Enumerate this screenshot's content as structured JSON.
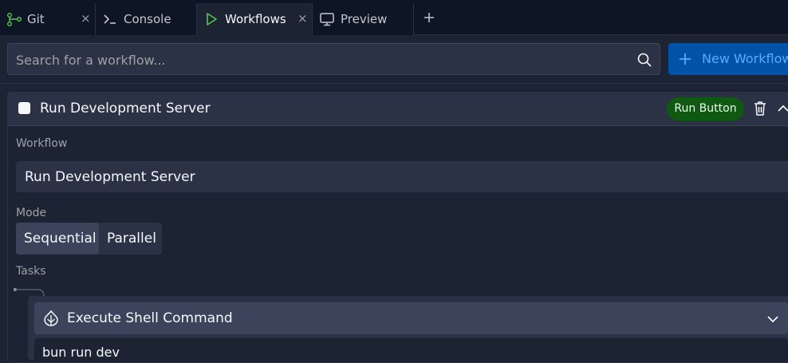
{
  "tabs": [
    {
      "label": "Git",
      "icon": "git-branch-icon",
      "closable": true
    },
    {
      "label": "Console",
      "icon": "terminal-icon",
      "closable": false
    },
    {
      "label": "Workflows",
      "icon": "play-icon",
      "closable": true,
      "active": true
    },
    {
      "label": "Preview",
      "icon": "monitor-icon",
      "closable": false
    }
  ],
  "tab_close_glyph": "×",
  "add_tab_icon": "plus-icon",
  "search": {
    "placeholder": "Search for a workflow...",
    "icon": "search-icon"
  },
  "new_workflow": {
    "label": "New Workflow",
    "icon": "plus-icon"
  },
  "workflow": {
    "title": "Run Development Server",
    "run_button": "Run Button",
    "field_label_workflow": "Workflow",
    "name_value": "Run Development Server",
    "field_label_mode": "Mode",
    "modes": [
      "Sequential",
      "Parallel"
    ],
    "selected_mode": "Sequential",
    "field_label_tasks": "Tasks",
    "task": {
      "title": "Execute Shell Command",
      "command": "bun run dev",
      "icon": "shell-command-icon"
    }
  },
  "colors": {
    "background": "#1c2333",
    "tabbar": "#0e1525",
    "panel": "#2b3245",
    "panel_light": "#3c445c",
    "accent_blue": "#0053a6",
    "accent_blue_text": "#57abff",
    "run_green": "#0f5913",
    "active_tab_icon": "#58c64b"
  }
}
